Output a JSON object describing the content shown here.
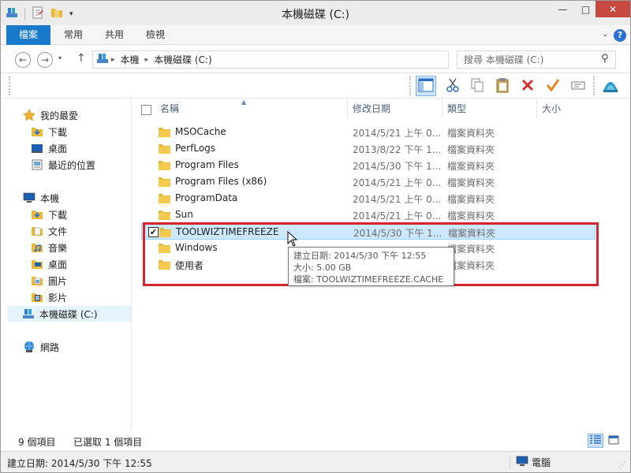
{
  "window": {
    "title": "本機磁碟 (C:)",
    "minimize": "—",
    "maximize": "□",
    "close": "✕"
  },
  "ribbon": {
    "tabs": [
      {
        "label": "檔案"
      },
      {
        "label": "常用"
      },
      {
        "label": "共用"
      },
      {
        "label": "檢視"
      }
    ],
    "help": "?"
  },
  "address_bar": {
    "crumbs": [
      "本機",
      "本機磁碟 (C:)"
    ],
    "search_placeholder": "搜尋 本機磁碟 (C:)"
  },
  "toolbar": {
    "icons": [
      "layout-pane-icon",
      "cut-icon",
      "copy-icon",
      "paste-icon",
      "delete-icon",
      "check-icon",
      "rename-icon",
      "shell-icon"
    ]
  },
  "nav": {
    "favorites": {
      "label": "我的最愛",
      "items": [
        "下載",
        "桌面",
        "最近的位置"
      ]
    },
    "this_pc": {
      "label": "本機",
      "items": [
        "下載",
        "文件",
        "音樂",
        "桌面",
        "圖片",
        "影片",
        "本機磁碟 (C:)"
      ]
    },
    "network": {
      "label": "網路"
    }
  },
  "columns": {
    "name": "名稱",
    "date": "修改日期",
    "type": "類型",
    "size": "大小"
  },
  "files": [
    {
      "name": "MSOCache",
      "date": "2014/5/21 上午 0...",
      "type": "檔案資料夾"
    },
    {
      "name": "PerfLogs",
      "date": "2013/8/22 下午 1...",
      "type": "檔案資料夾"
    },
    {
      "name": "Program Files",
      "date": "2014/5/30 下午 1...",
      "type": "檔案資料夾"
    },
    {
      "name": "Program Files (x86)",
      "date": "2014/5/21 上午 0...",
      "type": "檔案資料夾"
    },
    {
      "name": "ProgramData",
      "date": "2014/5/21 上午 0...",
      "type": "檔案資料夾"
    },
    {
      "name": "Sun",
      "date": "2014/5/21 上午 0...",
      "type": "檔案資料夾"
    },
    {
      "name": "TOOLWIZTIMEFREEZE",
      "date": "2014/5/30 下午 1...",
      "type": "檔案資料夾",
      "selected": true
    },
    {
      "name": "Windows",
      "date": "",
      "type": "檔案資料夾"
    },
    {
      "name": "使用者",
      "date": "",
      "type": "檔案資料夾"
    }
  ],
  "tooltip": {
    "line1": "建立日期: 2014/5/30 下午 12:55",
    "line2": "大小: 5.00 GB",
    "line3": "檔案: TOOLWIZTIMEFREEZE.CACHE"
  },
  "status": {
    "item_count": "9 個項目",
    "selected_count": "已選取 1 個項目",
    "bottom_detail": "建立日期: 2014/5/30 下午 12:55",
    "location": "電腦"
  },
  "colors": {
    "accent": "#1979ca",
    "selection": "#cce8ff",
    "highlight_box": "#d4252e",
    "folder": "#e8b93b"
  }
}
